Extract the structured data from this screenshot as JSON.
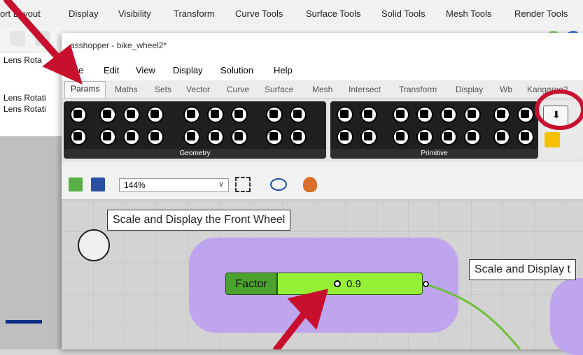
{
  "rhino": {
    "ribbon_tabs": [
      "ort Layout",
      "Display",
      "Visibility",
      "Transform",
      "Curve Tools",
      "Surface Tools",
      "Solid Tools",
      "Mesh Tools",
      "Render Tools"
    ],
    "left_panel_rows": [
      "Lens Rota",
      "Lens Rotati",
      "Lens Rotati"
    ]
  },
  "gh": {
    "title": "asshopper - bike_wheel2*",
    "menu": [
      "e",
      "Edit",
      "View",
      "Display",
      "Solution",
      "Help"
    ],
    "tabs": [
      "Params",
      "Maths",
      "Sets",
      "Vector",
      "Curve",
      "Surface",
      "Mesh",
      "Intersect",
      "Transform",
      "Display",
      "Wb",
      "Kangaroo2"
    ],
    "groups": [
      "Geometry",
      "Primitive"
    ],
    "zoom": "144%",
    "callouts": {
      "front": "Scale and Display the Front Wheel",
      "rear": "Scale and Display t"
    },
    "slider": {
      "name": "Factor",
      "value": "0.9",
      "fraction": 0.45
    }
  },
  "colors": {
    "arrow": "#c8102e",
    "group": "#bfa4ee",
    "slider": "#95f135"
  }
}
